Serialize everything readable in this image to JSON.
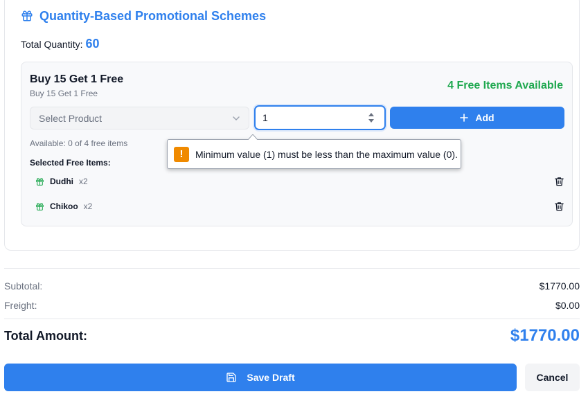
{
  "section": {
    "title": "Quantity-Based Promotional Schemes",
    "icon": "gift-icon",
    "accent": "#2f80ed"
  },
  "total_quantity": {
    "label": "Total Quantity:",
    "value": "60"
  },
  "scheme": {
    "name": "Buy 15 Get 1 Free",
    "subtitle": "Buy 15 Get 1 Free",
    "free_available": "4 Free Items Available",
    "free_color": "#1fa84f",
    "product_select": {
      "placeholder": "Select Product"
    },
    "quantity_input": {
      "value": "1"
    },
    "add_label": "Add",
    "available_text": "Available: 0 of 4 free items",
    "selected_label": "Selected Free Items:",
    "items": [
      {
        "name": "Dudhi",
        "qty": "x2"
      },
      {
        "name": "Chikoo",
        "qty": "x2"
      }
    ]
  },
  "validation_tooltip": {
    "icon": "warning-icon",
    "message": "Minimum value (1) must be less than the maximum value (0)."
  },
  "summary": {
    "subtotal_label": "Subtotal:",
    "subtotal_value": "$1770.00",
    "freight_label": "Freight:",
    "freight_value": "$0.00",
    "total_label": "Total Amount:",
    "total_value": "$1770.00"
  },
  "actions": {
    "save_label": "Save Draft",
    "cancel_label": "Cancel"
  }
}
